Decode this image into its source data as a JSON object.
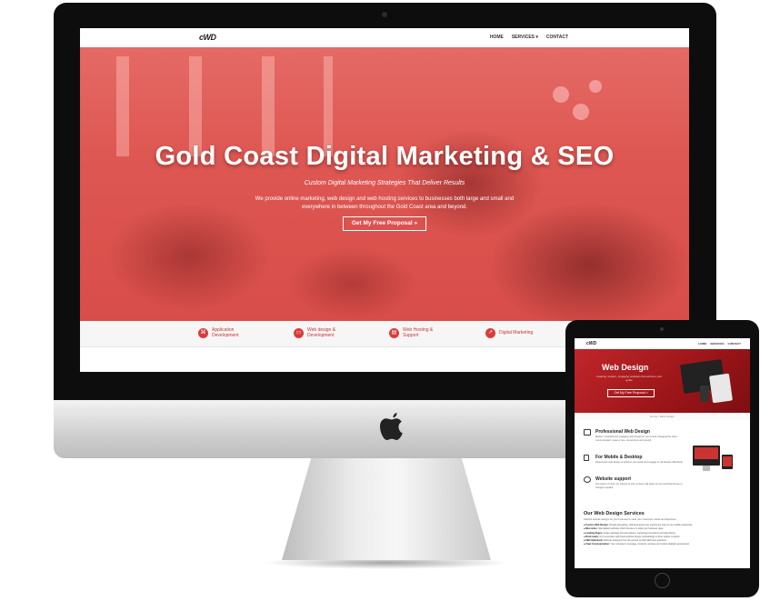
{
  "desktop": {
    "logo": "cWD",
    "nav": {
      "home": "HOME",
      "services": "SERVICES",
      "services_caret": "▾",
      "contact": "CONTACT"
    },
    "hero": {
      "title": "Gold Coast Digital Marketing & SEO",
      "subtitle": "Custom Digital Marketing Strategies That Deliver Results",
      "description": "We provide online marketing, web design and web hosting services to businesses both large and small and everywhere in between throughout the Gold Coast area and beyond.",
      "cta": "Get My Free Proposal »"
    },
    "services": [
      {
        "icon": "code-icon",
        "glyph": "⌘",
        "label": "Application Development"
      },
      {
        "icon": "monitor-icon",
        "glyph": "▭",
        "label": "Web design & Development"
      },
      {
        "icon": "server-icon",
        "glyph": "▤",
        "label": "Web Hosting & Support"
      },
      {
        "icon": "chart-icon",
        "glyph": "↗",
        "label": "Digital Marketing"
      }
    ]
  },
  "tablet": {
    "logo": "cWD",
    "nav": {
      "home": "HOME",
      "services": "SERVICES",
      "contact": "CONTACT"
    },
    "hero": {
      "title": "Web Design",
      "subtitle": "Creating modern, engaging websites that achieve your goals",
      "cta": "Get My Free Proposal »"
    },
    "breadcrumb": "Home  |  Web Design",
    "features": [
      {
        "title": "Professional Web Design",
        "desc": "Modern, beautiful and engaging web design for your brand. Designed for clear communication, ease of use, conversions and growth."
      },
      {
        "title": "For Mobile & Desktop",
        "desc": "Responsive web design to achieve your goals and engage on all devices effectively."
      },
      {
        "title": "Website support",
        "desc": "For peace of mind, our support is only a phone call away for any technical issues or changes needed."
      }
    ],
    "services_title": "Our Web Design Services",
    "services_desc": "Tailored website designs for your business to meet your customers needs and objectives.",
    "services_list": [
      {
        "name": "Custom Web Design:",
        "text": "Visually appealing, optimised great user experience easy to use mobile responsive."
      },
      {
        "name": "Microsites:",
        "text": "Specialised websites which focuses on what your business does."
      },
      {
        "name": "Landing Pages:",
        "text": "Single webpage for lead capture, marketing promotions and advertising."
      },
      {
        "name": "Brisk ready:",
        "text": "Our conversion-optimised website design methodology to drive visitors to action."
      },
      {
        "name": "SEO Optimised:",
        "text": "Website designed from the ground up with SEO best practices."
      },
      {
        "name": "Clear Communication:",
        "text": "Your company's message, products, services and culture digitally represented."
      }
    ]
  }
}
